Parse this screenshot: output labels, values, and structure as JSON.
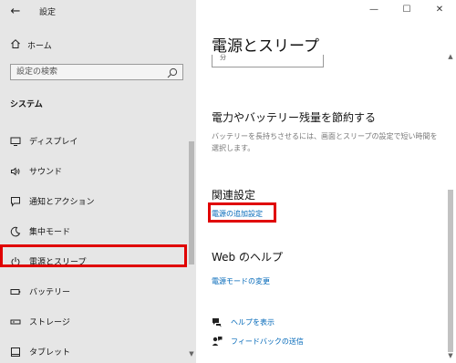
{
  "window": {
    "title": "設定",
    "back_glyph": "←",
    "minimize_glyph": "—",
    "maximize_glyph": "☐",
    "close_glyph": "✕"
  },
  "sidebar": {
    "home": {
      "label": "ホーム",
      "icon": "home-icon"
    },
    "search": {
      "placeholder": "設定の検索",
      "icon": "search-icon"
    },
    "section": "システム",
    "items": [
      {
        "label": "ディスプレイ",
        "icon": "display-icon"
      },
      {
        "label": "サウンド",
        "icon": "speaker-icon"
      },
      {
        "label": "通知とアクション",
        "icon": "notification-icon"
      },
      {
        "label": "集中モード",
        "icon": "moon-icon"
      },
      {
        "label": "電源とスリープ",
        "icon": "power-icon",
        "selected": true
      },
      {
        "label": "バッテリー",
        "icon": "battery-icon"
      },
      {
        "label": "ストレージ",
        "icon": "storage-icon"
      },
      {
        "label": "タブレット",
        "icon": "tablet-icon"
      }
    ],
    "scroll_down_glyph": "▼"
  },
  "main": {
    "page_title": "電源とスリープ",
    "dropdown_partial_text": "分",
    "battery_section": {
      "heading": "電力やバッテリー残量を節約する",
      "description": "バッテリーを長持ちさせるには、画面とスリープの設定で短い時間を選択します。"
    },
    "related": {
      "heading": "関連設定",
      "link": "電源の追加設定"
    },
    "web_help": {
      "heading": "Web のヘルプ",
      "link": "電源モードの変更"
    },
    "help_links": [
      {
        "label": "ヘルプを表示",
        "icon": "help-chat-icon"
      },
      {
        "label": "フィードバックの送信",
        "icon": "feedback-icon"
      }
    ],
    "scroll_up_glyph": "▲",
    "scroll_down_glyph": "▼"
  },
  "colors": {
    "sidebar_bg": "#e6e6e6",
    "link": "#0067b8",
    "highlight": "#e00000"
  }
}
